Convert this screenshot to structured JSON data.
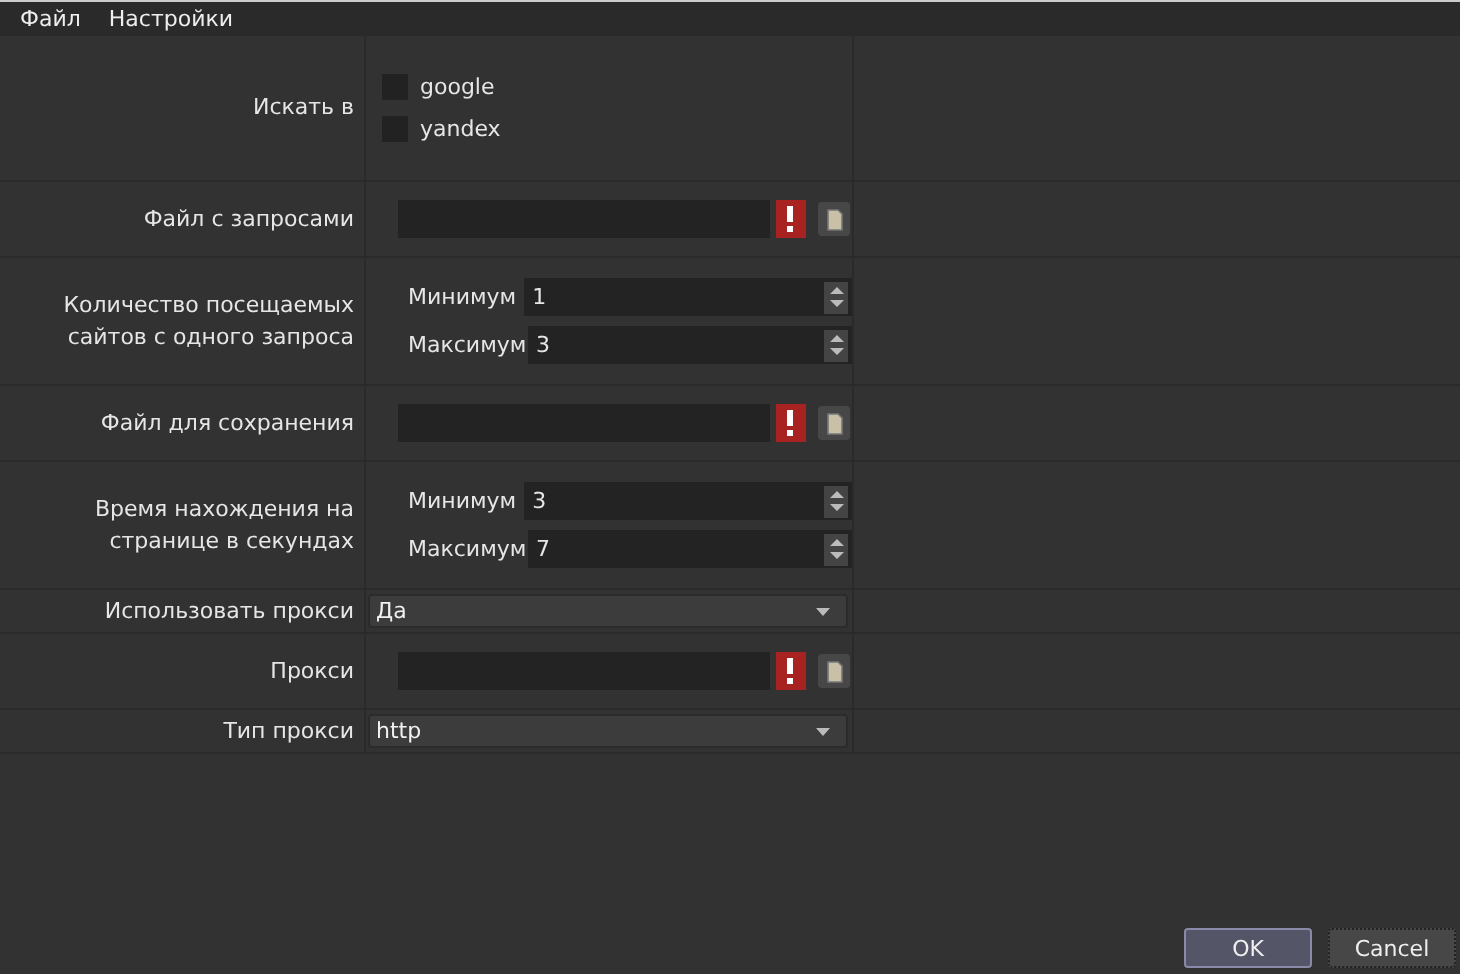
{
  "menu": [
    "Файл",
    "Настройки"
  ],
  "rows": [
    {
      "kind": "checks",
      "label": "Искать в",
      "options": [
        {
          "label": "google",
          "checked": false
        },
        {
          "label": "yandex",
          "checked": false
        }
      ]
    },
    {
      "kind": "file",
      "label": "Файл с запросами",
      "invalid": true
    },
    {
      "kind": "range",
      "label": "Количество посещаемых сайтов с одного запроса",
      "fields": [
        {
          "label": "Минимум",
          "value": "1"
        },
        {
          "label": "Максимум",
          "value": "3"
        }
      ]
    },
    {
      "kind": "file",
      "label": "Файл для сохранения",
      "invalid": true
    },
    {
      "kind": "range",
      "label": "Время нахождения на странице в секундах",
      "fields": [
        {
          "label": "Минимум",
          "value": "3"
        },
        {
          "label": "Максимум",
          "value": "7"
        }
      ]
    },
    {
      "kind": "combo",
      "label": "Использовать прокси",
      "value": "Да"
    },
    {
      "kind": "file",
      "label": "Прокси",
      "invalid": true
    },
    {
      "kind": "combo",
      "label": "Тип прокси",
      "value": "http"
    }
  ],
  "buttons": [
    {
      "label": "OK",
      "default": true
    },
    {
      "label": "Cancel",
      "default": false
    }
  ]
}
